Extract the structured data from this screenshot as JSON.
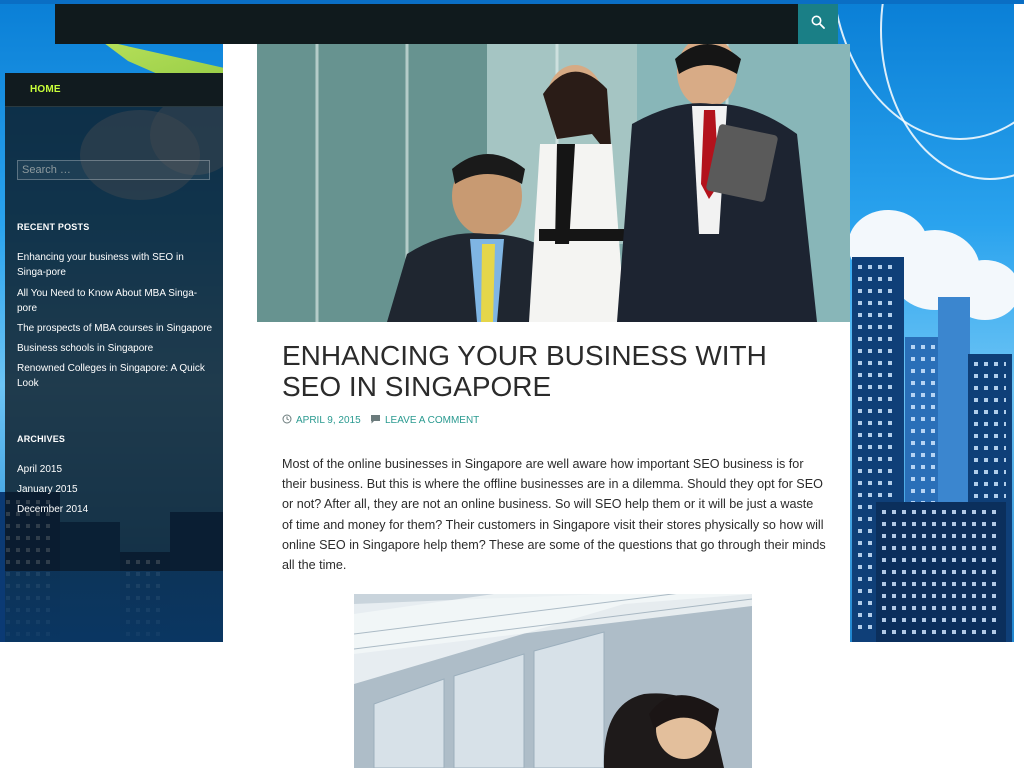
{
  "header": {
    "search_toggle_icon": "search-icon"
  },
  "nav": {
    "home_label": "HOME"
  },
  "sidebar": {
    "search_placeholder": "Search …",
    "recent_posts": {
      "title": "RECENT POSTS",
      "items": [
        "Enhancing your business with SEO in Singa-pore",
        "All You Need to Know About MBA Singa-pore",
        "The prospects of MBA courses in Singapore",
        "Business schools in Singapore",
        "Renowned Colleges in Singapore: A Quick Look"
      ]
    },
    "archives": {
      "title": "ARCHIVES",
      "items": [
        "April 2015",
        "January 2015",
        "December 2014"
      ]
    }
  },
  "post": {
    "title": "ENHANCING YOUR BUSINESS WITH SEO IN SINGAPORE",
    "date": "APRIL 9, 2015",
    "date_icon": "clock-icon",
    "comment_label": "LEAVE A COMMENT",
    "comment_icon": "speech-bubble-icon",
    "body": "Most of the online businesses in Singapore are well aware how important SEO business is for their business. But this is where the offline businesses are in a dilemma. Should they opt for SEO or not? After all, they are not an online business. So will SEO help them or it will be just a waste of time and money for them? Their customers in Singapore visit their stores physically so how will online SEO in Singapore help them? These are some of the questions that go through their minds all the time."
  },
  "colors": {
    "accent_green": "#c9ff3a",
    "link_teal": "#2a9a90",
    "search_button": "#1a7f86",
    "topbar": "#101a1d"
  }
}
